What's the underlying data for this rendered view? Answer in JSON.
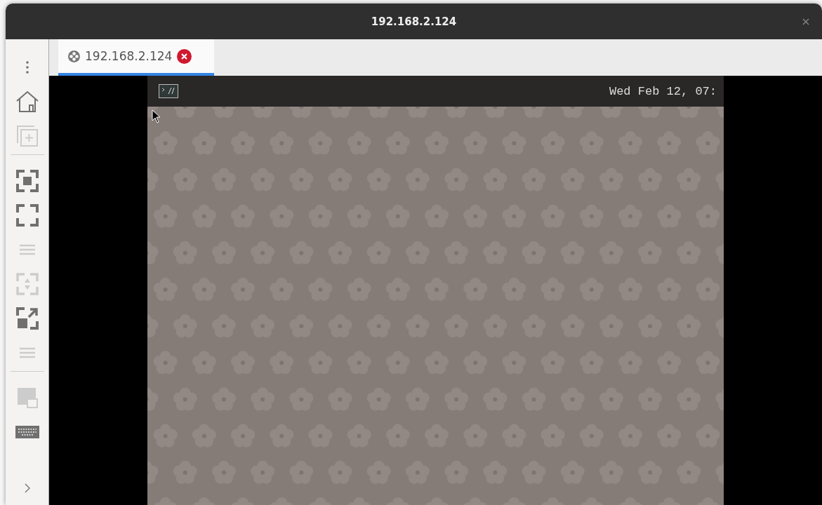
{
  "window": {
    "title": "192.168.2.124"
  },
  "toolbar": [
    {
      "kind": "menu",
      "disabled": false
    },
    {
      "kind": "home",
      "disabled": false
    },
    {
      "kind": "newtab",
      "disabled": true
    },
    {
      "kind": "divider"
    },
    {
      "kind": "fit",
      "disabled": false
    },
    {
      "kind": "fullscreen",
      "disabled": false
    },
    {
      "kind": "grip",
      "disabled": true
    },
    {
      "kind": "scale",
      "disabled": true
    },
    {
      "kind": "resize",
      "disabled": false
    },
    {
      "kind": "grip",
      "disabled": true
    },
    {
      "kind": "divider"
    },
    {
      "kind": "window",
      "disabled": true
    },
    {
      "kind": "keyboard",
      "disabled": false
    },
    {
      "kind": "spacer"
    },
    {
      "kind": "expand",
      "disabled": false
    }
  ],
  "tabs": [
    {
      "label": "192.168.2.124",
      "selected": true
    }
  ],
  "remote": {
    "clock": "Wed Feb 12, 07:"
  }
}
